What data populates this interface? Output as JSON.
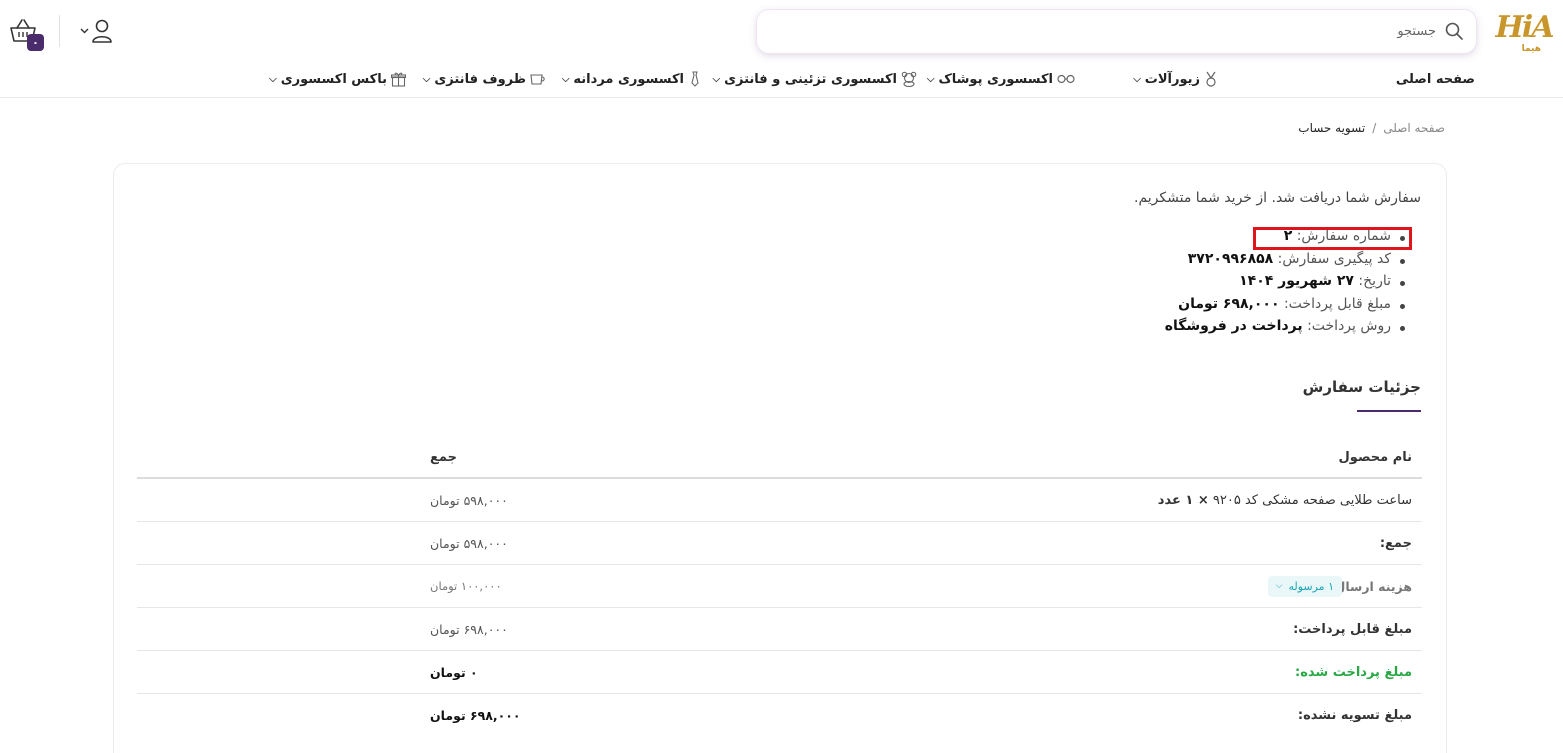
{
  "header": {
    "logo_text": "HiA",
    "logo_subtext": "هیما",
    "search_placeholder": "جستجو",
    "cart_count": "۰"
  },
  "nav": {
    "items": [
      {
        "label": "صفحه اصلی",
        "icon": "none",
        "dropdown": false
      },
      {
        "label": "زیورآلات",
        "icon": "medal-icon",
        "dropdown": true
      },
      {
        "label": "اکسسوری پوشاک",
        "icon": "glasses-icon",
        "dropdown": true
      },
      {
        "label": "اکسسوری تزئینی و فانتزی",
        "icon": "teddy-bear-icon",
        "dropdown": true
      },
      {
        "label": "اکسسوری مردانه",
        "icon": "tie-icon",
        "dropdown": true
      },
      {
        "label": "ظروف فانتزی",
        "icon": "cup-icon",
        "dropdown": true
      },
      {
        "label": "باکس اکسسوری",
        "icon": "gift-box-icon",
        "dropdown": true
      }
    ]
  },
  "breadcrumb": {
    "home": "صفحه اصلی",
    "separator": "/",
    "current": "تسویه حساب"
  },
  "order": {
    "thanks": "سفارش شما دریافت شد. از خرید شما متشکریم.",
    "overview": [
      {
        "label": "شماره سفارش:",
        "value": "۲"
      },
      {
        "label": "کد پیگیری سفارش:",
        "value": "۳۷۲۰۹۹۶۸۵۸"
      },
      {
        "label": "تاریخ:",
        "value": "۲۷ شهریور ۱۴۰۴"
      },
      {
        "label": "مبلغ قابل پرداخت:",
        "value": "۶۹۸,۰۰۰ تومان"
      },
      {
        "label": "روش پرداخت:",
        "value": "پرداخت در فروشگاه"
      }
    ]
  },
  "details": {
    "title": "جزئیات سفارش",
    "col_product": "نام محصول",
    "col_total": "جمع",
    "product": {
      "name": "ساعت طلایی صفحه مشکی کد ۹۲۰۵",
      "qty": "× ۱ عدد",
      "total": "۵۹۸,۰۰۰ تومان"
    },
    "subtotal": {
      "label": "جمع:",
      "value": "۵۹۸,۰۰۰ تومان"
    },
    "shipping": {
      "label": "هزینه ارسال:",
      "badge": "۱ مرسوله",
      "value": "۱۰۰,۰۰۰ تومان"
    },
    "payable": {
      "label": "مبلغ قابل پرداخت:",
      "value": "۶۹۸,۰۰۰ تومان"
    },
    "paid": {
      "label": "مبلغ پرداخت شده:",
      "value": "۰ تومان"
    },
    "unpaid": {
      "label": "مبلغ تسویه نشده:",
      "value": "۶۹۸,۰۰۰ تومان"
    }
  },
  "colors": {
    "brand_purple": "#4a2b6b",
    "gold": "#c9962b",
    "highlight_red": "#e0151b",
    "paid_green": "#28a745",
    "badge_teal": "#1ba5b8"
  }
}
